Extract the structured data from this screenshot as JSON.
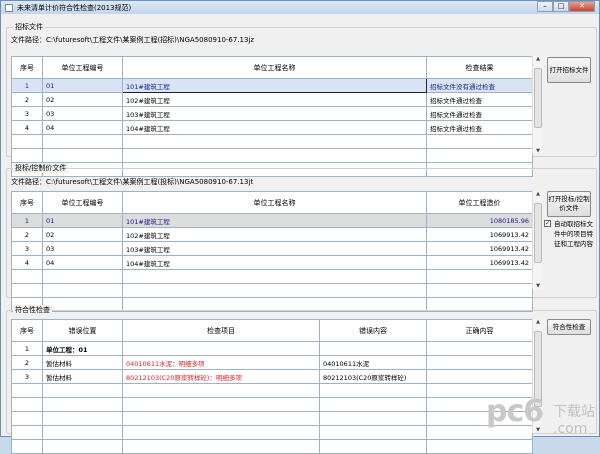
{
  "window": {
    "title": "未来清单计价符合性检查(2013规范)",
    "min": "–",
    "max": "□",
    "close": "✕"
  },
  "bid": {
    "group_label": "招标文件",
    "path": "文件路径：C:\\futuresoft\\工程文件\\某案例工程(招标)\\NGA5080910-67.13jz",
    "headers": [
      "序号",
      "单位工程编号",
      "单位工程名称",
      "检查结果"
    ],
    "rows": [
      [
        "1",
        "01",
        "101#建筑工程",
        "招标文件没有通过检查"
      ],
      [
        "2",
        "02",
        "102#建筑工程",
        "招标文件通过检查"
      ],
      [
        "3",
        "03",
        "103#建筑工程",
        "招标文件通过检查"
      ],
      [
        "4",
        "04",
        "104#建筑工程",
        "招标文件通过检查"
      ]
    ],
    "open_button": "打开招标文件"
  },
  "tender": {
    "group_label": "投标/控制价文件",
    "path": "文件路径：C:\\futuresoft\\工程文件\\某案例工程(投标)\\NGA5080910-67.13jt",
    "headers": [
      "序号",
      "单位工程编号",
      "单位工程名称",
      "单位工程造价"
    ],
    "rows": [
      [
        "1",
        "01",
        "101#建筑工程",
        "1080185.96"
      ],
      [
        "2",
        "02",
        "102#建筑工程",
        "1069913.42"
      ],
      [
        "3",
        "03",
        "103#建筑工程",
        "1069913.42"
      ],
      [
        "4",
        "04",
        "104#建筑工程",
        "1069913.42"
      ]
    ],
    "open_button": "打开投标/控制价文件",
    "auto_checkbox": "自动取招标文件中的项目特征和工程内容",
    "auto_checked": true
  },
  "check": {
    "group_label": "符合性检查",
    "headers": [
      "序号",
      "错误位置",
      "检查项目",
      "错误内容",
      "正确内容"
    ],
    "rows": [
      [
        "1",
        "单位工程：01",
        "",
        "",
        ""
      ],
      [
        "2",
        "暂估材料",
        "04010611水泥：明细多项",
        "04010611水泥",
        ""
      ],
      [
        "3",
        "暂估材料",
        "80212103(C20原浆转样砼)：明细多项",
        "80212103(C20原浆转样砼)",
        ""
      ]
    ],
    "check_button": "符合性检查"
  },
  "watermark": {
    "logo": "pc6",
    "text": "下载站 .com"
  }
}
